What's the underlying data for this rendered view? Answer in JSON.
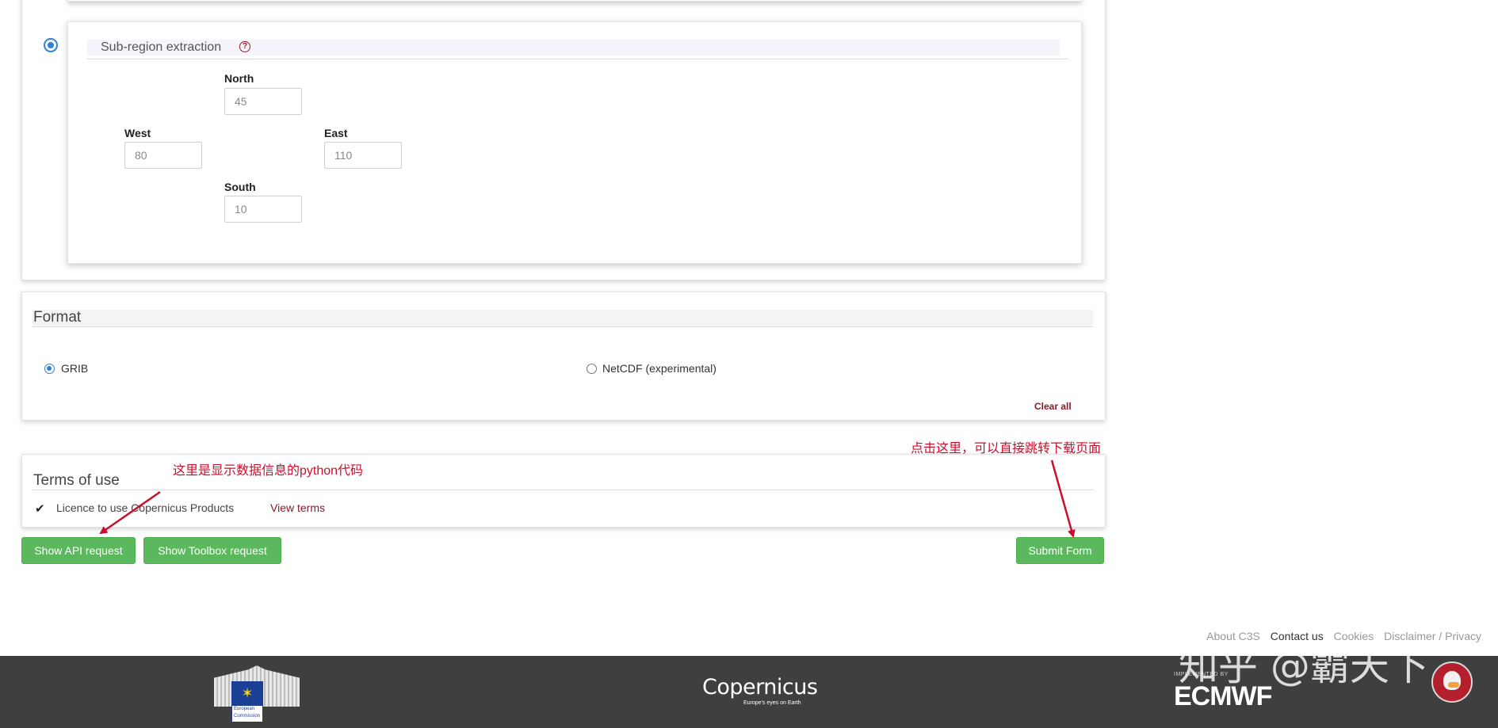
{
  "region": {
    "title": "Sub-region extraction",
    "help_icon": "?",
    "north_label": "North",
    "north_value": "45",
    "west_label": "West",
    "west_value": "80",
    "east_label": "East",
    "east_value": "110",
    "south_label": "South",
    "south_value": "10"
  },
  "format": {
    "title": "Format",
    "option_grib": "GRIB",
    "option_netcdf": "NetCDF (experimental)",
    "selected": "GRIB",
    "clear_all": "Clear all"
  },
  "terms": {
    "title": "Terms of use",
    "check_icon": "check-icon",
    "licence": "Licence to use Copernicus Products",
    "view_terms": "View terms"
  },
  "buttons": {
    "show_api": "Show API request",
    "show_toolbox": "Show Toolbox request",
    "submit": "Submit Form"
  },
  "annotations": {
    "api_note": "这里是显示数据信息的python代码",
    "submit_note": "点击这里，可以直接跳转下载页面",
    "color": "#c8102e"
  },
  "footer": {
    "links": [
      "About C3S",
      "Contact us",
      "Cookies",
      "Disclaimer / Privacy"
    ],
    "eu_logo_text": "European Commission",
    "copernicus_logo": "Copernicus",
    "copernicus_tagline": "Europe's eyes on Earth",
    "ecmwf_small": "IMPLEMENTED BY",
    "ecmwf_logo": "ECMWF",
    "watermark": "知乎 @霸天下"
  },
  "colors": {
    "accent_blue": "#2f7fd6",
    "button_green": "#5cb85c",
    "link_red": "#8a1a2a",
    "footer_bg": "#3f3f3f"
  }
}
